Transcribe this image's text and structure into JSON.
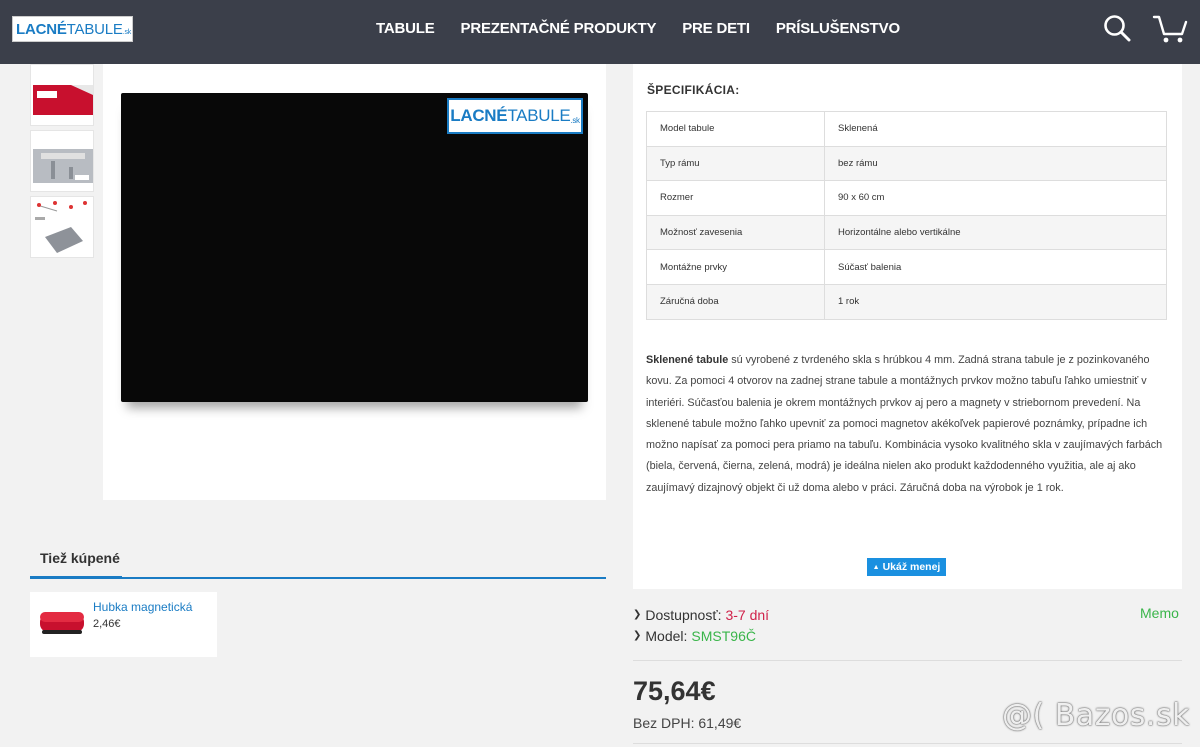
{
  "header": {
    "logo": {
      "part1": "LACNÉ",
      "part2": "TABULE",
      "part3": ".sk"
    },
    "nav": [
      "TABULE",
      "PREZENTAČNÉ PRODUKTY",
      "PRE DETI",
      "PRÍSLUŠENSTVO"
    ],
    "icons": [
      "search-icon",
      "cart-icon"
    ]
  },
  "gallery": {
    "board_logo": {
      "part1": "LACNÉ",
      "part2": "TABULE",
      "part3": ".sk"
    }
  },
  "also_bought": {
    "tab_label": "Tiež kúpené",
    "items": [
      {
        "name": "Hubka magnetická",
        "price": "2,46€"
      }
    ]
  },
  "specs": {
    "title": "ŠPECIFIKÁCIA:",
    "rows": [
      {
        "label": "Model tabule",
        "value": "Sklenená"
      },
      {
        "label": "Typ rámu",
        "value": "bez rámu"
      },
      {
        "label": "Rozmer",
        "value": "90 x 60 cm"
      },
      {
        "label": "Možnosť zavesenia",
        "value": "Horizontálne alebo vertikálne"
      },
      {
        "label": "Montážne prvky",
        "value": "Súčasť balenia"
      },
      {
        "label": "Záručná doba",
        "value": "1 rok"
      }
    ],
    "description_bold": "Sklenené tabule",
    "description": " sú vyrobené z tvrdeného skla s hrúbkou 4 mm. Zadná strana tabule je z pozinkovaného kovu. Za pomoci 4 otvorov na zadnej strane tabule a montážnych prvkov možno tabuľu ľahko umiestniť v interiéri. Súčasťou balenia je okrem montážnych prvkov aj pero a magnety v striebornom prevedení. Na sklenené tabule možno ľahko upevniť za pomoci magnetov akékoľvek papierové poznámky, prípadne ich možno napísať za pomoci pera priamo na tabuľu. Kombinácia vysoko kvalitného skla v zaujímavých farbách (biela, červená, čierna, zelená, modrá) je ideálna nielen ako produkt každodenného využitia, ale aj ako zaujímavý dizajnový objekt či už doma alebo v práci. Záručná doba na výrobok je 1 rok.",
    "less_button": "Ukáž menej"
  },
  "product_info": {
    "availability_label": "Dostupnosť:",
    "availability_value": "3-7 dní",
    "model_label": "Model:",
    "model_value": "SMST96Č",
    "brand": "Memo",
    "price": "75,64€",
    "price_no_vat": "Bez DPH: 61,49€"
  },
  "watermark": "@( Bazos.sk",
  "colors": {
    "header": "#3b3f4a",
    "accent": "#1a7cc4",
    "button": "#1a90e0",
    "availability": "#d0224a",
    "green": "#3ab54a"
  }
}
